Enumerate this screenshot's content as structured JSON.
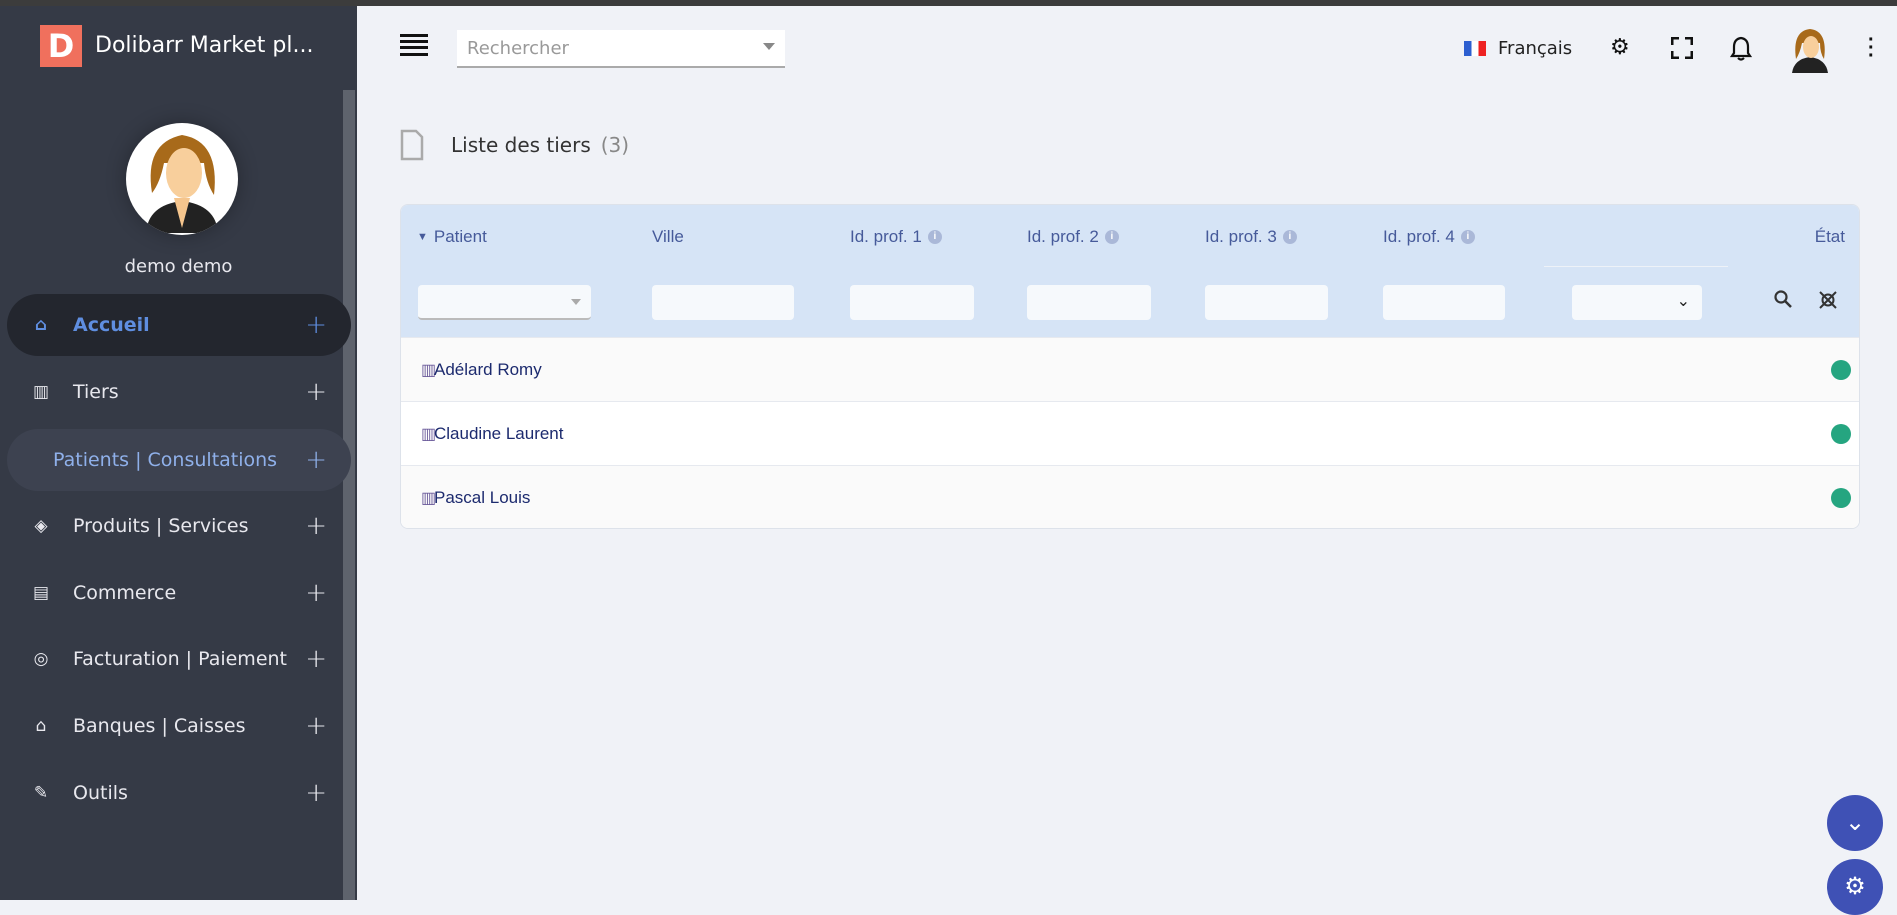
{
  "app": {
    "title": "Dolibarr Market pl...",
    "logo_letter": "D"
  },
  "user": {
    "name": "demo demo"
  },
  "sidebar": {
    "items": [
      {
        "label": "Accueil",
        "icon": "home-icon",
        "glyph": "⌂",
        "active": true
      },
      {
        "label": "Tiers",
        "icon": "building-icon",
        "glyph": "▥"
      },
      {
        "label": "Patients | Consultations",
        "icon": "",
        "glyph": "",
        "sub": true
      },
      {
        "label": "Produits | Services",
        "icon": "cube-icon",
        "glyph": "◈"
      },
      {
        "label": "Commerce",
        "icon": "briefcase-icon",
        "glyph": "▤"
      },
      {
        "label": "Facturation | Paiement",
        "icon": "coins-icon",
        "glyph": "◎"
      },
      {
        "label": "Banques | Caisses",
        "icon": "bank-icon",
        "glyph": "⌂"
      },
      {
        "label": "Outils",
        "icon": "wrench-icon",
        "glyph": "✎"
      }
    ],
    "plus": "+"
  },
  "topbar": {
    "search_placeholder": "Rechercher",
    "language": "Français"
  },
  "page": {
    "title": "Liste des tiers",
    "count": "(3)"
  },
  "table": {
    "columns": [
      "Patient",
      "Ville",
      "Id. prof. 1",
      "Id. prof. 2",
      "Id. prof. 3",
      "Id. prof. 4",
      "État"
    ],
    "info_glyph": "i",
    "rows": [
      {
        "name": "Adélard Romy",
        "status": "active"
      },
      {
        "name": "Claudine Laurent",
        "status": "active"
      },
      {
        "name": "Pascal Louis",
        "status": "active"
      }
    ],
    "status_color": "#25a580"
  },
  "colors": {
    "sidebar": "#353a46",
    "accent": "#3f51b5",
    "logo": "#f0705d"
  }
}
